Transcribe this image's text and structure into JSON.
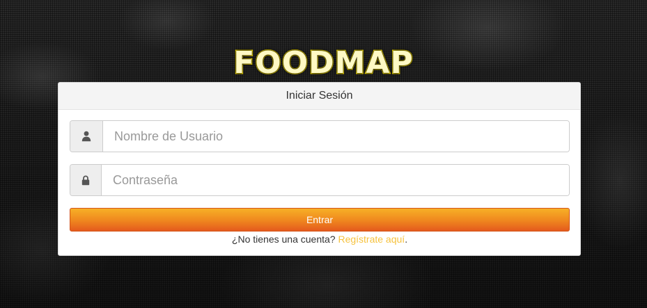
{
  "brand": {
    "name": "FOODMAP"
  },
  "login": {
    "heading": "Iniciar Sesión",
    "username": {
      "icon": "user-icon",
      "placeholder": "Nombre de Usuario",
      "value": ""
    },
    "password": {
      "icon": "lock-icon",
      "placeholder": "Contraseña",
      "value": ""
    },
    "submit_label": "Entrar",
    "register_prompt": "¿No tienes una cuenta?",
    "register_link": "Regístrate aquí",
    "register_suffix": "."
  },
  "colors": {
    "brand_outline": "#ffe600",
    "button_top": "#f7b026",
    "button_bottom": "#e45a1d",
    "link": "#f6c23e"
  }
}
